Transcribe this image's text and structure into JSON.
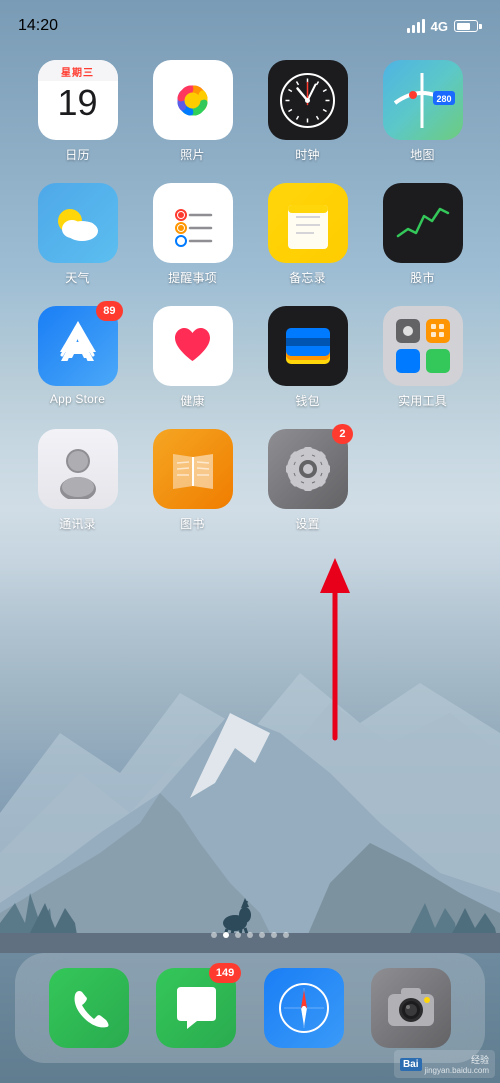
{
  "status_bar": {
    "time": "14:20",
    "network": "4G"
  },
  "apps_row1": [
    {
      "id": "calendar",
      "label": "日历",
      "date_label": "星期三",
      "date": "19"
    },
    {
      "id": "photos",
      "label": "照片"
    },
    {
      "id": "clock",
      "label": "时钟"
    },
    {
      "id": "maps",
      "label": "地图"
    }
  ],
  "apps_row2": [
    {
      "id": "weather",
      "label": "天气"
    },
    {
      "id": "reminders",
      "label": "提醒事项"
    },
    {
      "id": "notes",
      "label": "备忘录"
    },
    {
      "id": "stocks",
      "label": "股市"
    }
  ],
  "apps_row3": [
    {
      "id": "appstore",
      "label": "App Store",
      "badge": "89"
    },
    {
      "id": "health",
      "label": "健康"
    },
    {
      "id": "wallet",
      "label": "钱包"
    },
    {
      "id": "utilities",
      "label": "实用工具"
    }
  ],
  "apps_row4": [
    {
      "id": "contacts",
      "label": "通讯录"
    },
    {
      "id": "books",
      "label": "图书"
    },
    {
      "id": "settings",
      "label": "设置",
      "badge": "2"
    }
  ],
  "dock": [
    {
      "id": "phone",
      "label": ""
    },
    {
      "id": "messages",
      "label": "",
      "badge": "149"
    },
    {
      "id": "safari",
      "label": ""
    },
    {
      "id": "camera",
      "label": ""
    }
  ],
  "page_dots": [
    false,
    true,
    false,
    false,
    false,
    false,
    false
  ],
  "watermark": "Bai 经验\njingyan.baidu.com"
}
